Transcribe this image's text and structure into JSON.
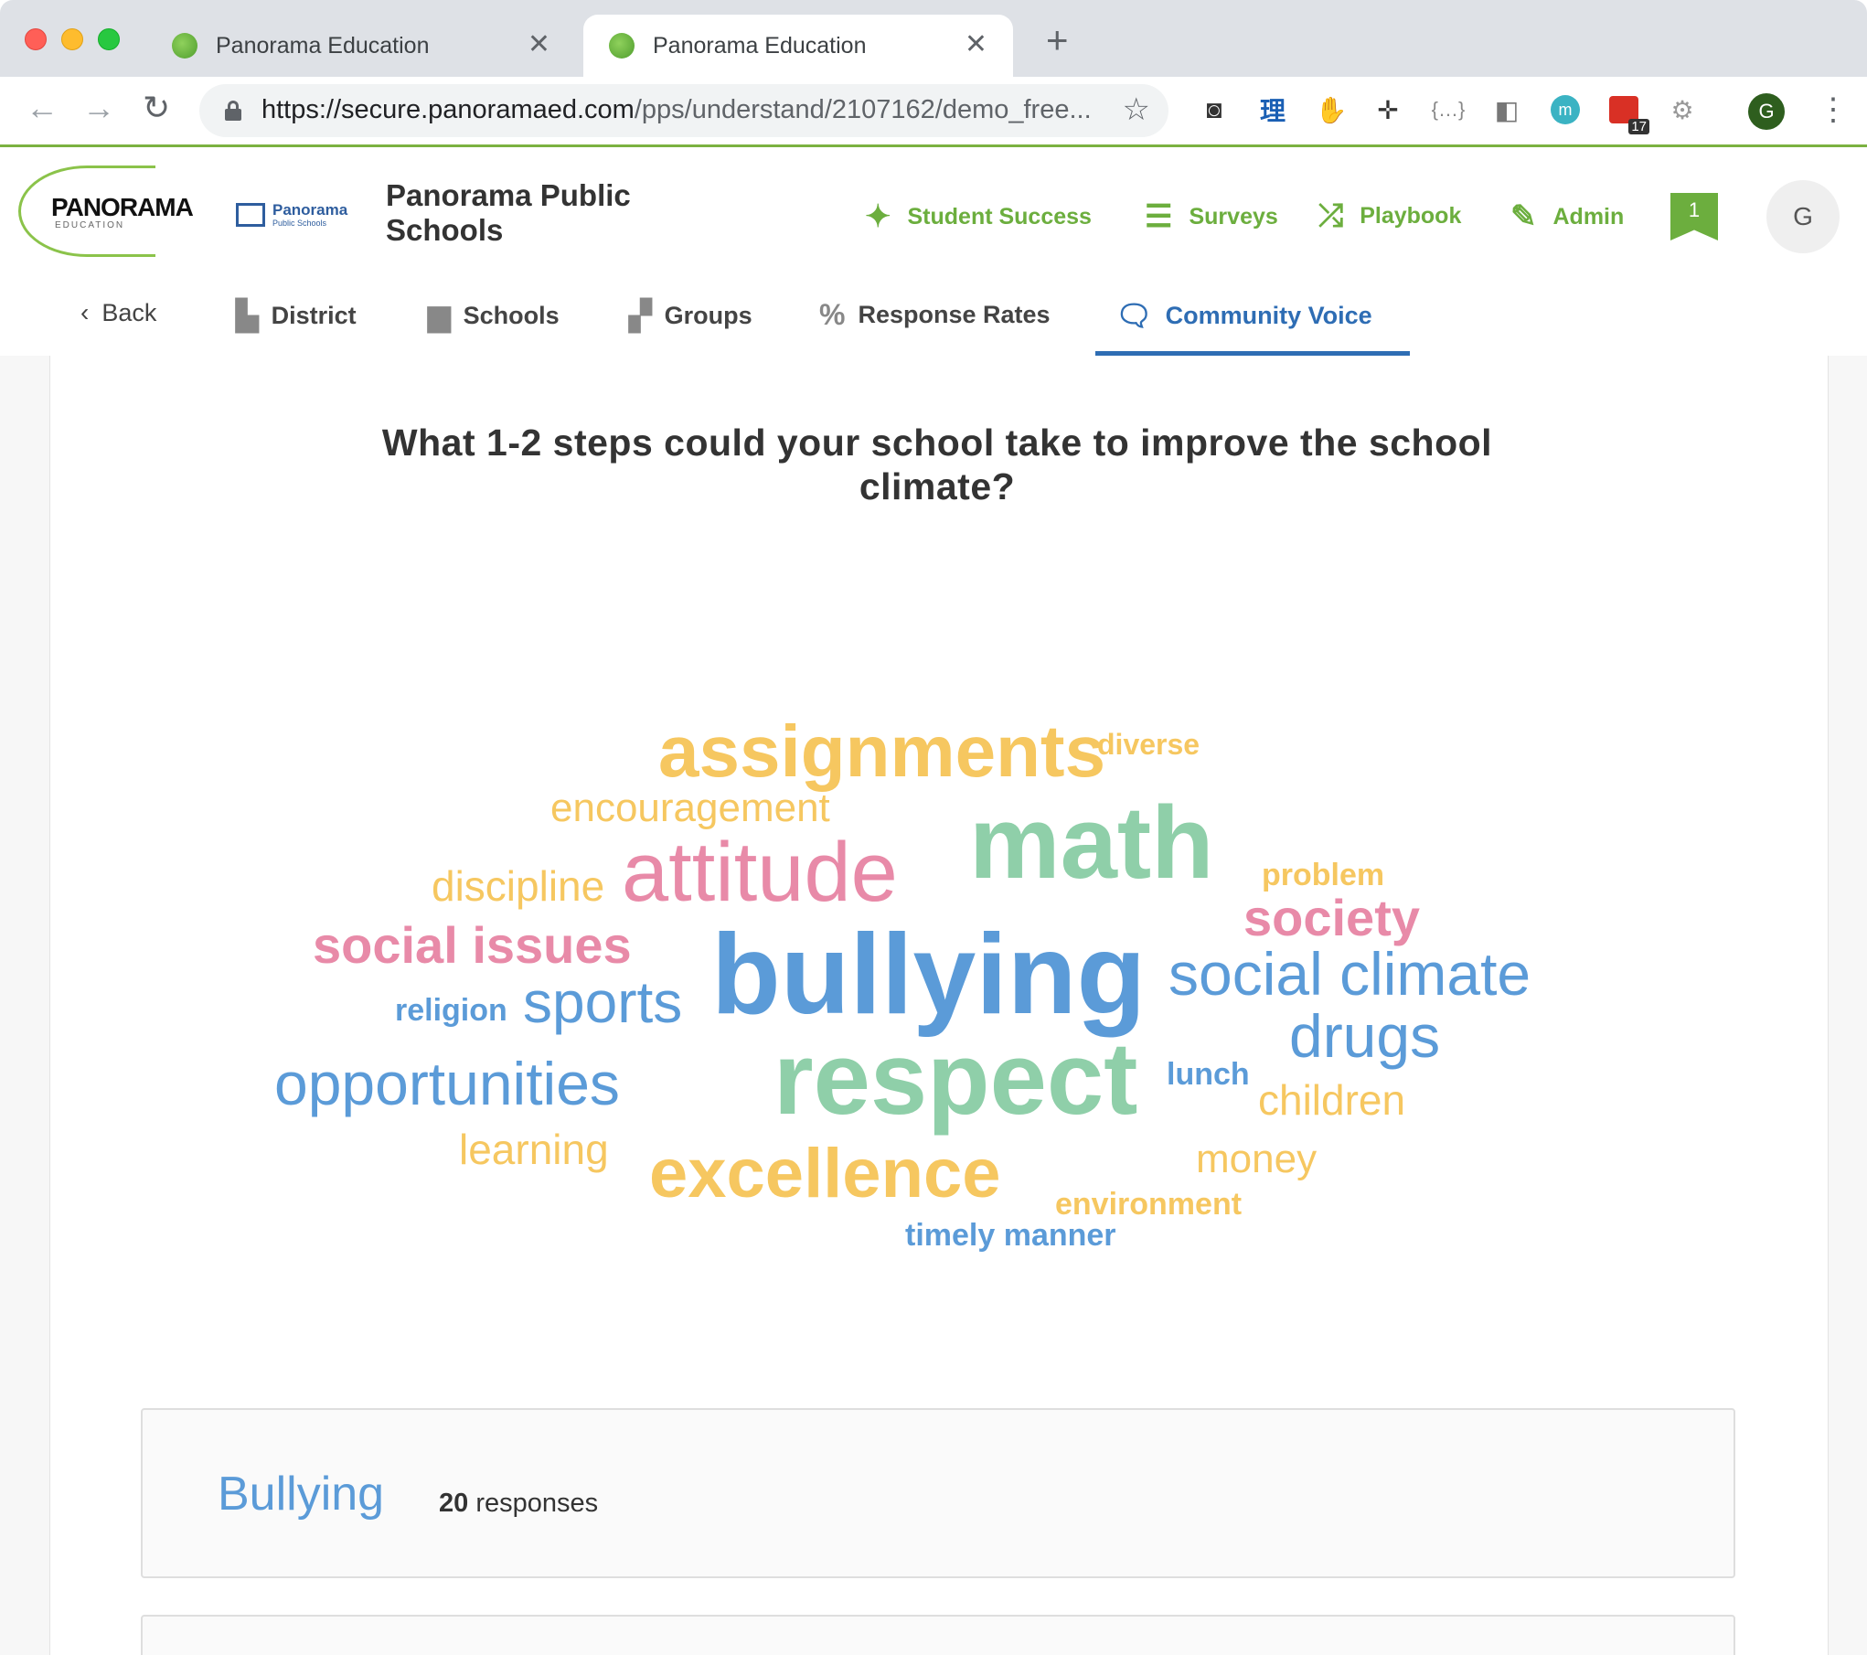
{
  "browser": {
    "tabs": [
      {
        "title": "Panorama Education"
      },
      {
        "title": "Panorama Education"
      }
    ],
    "url_host": "https://secure.panoramaed.com",
    "url_path": "/pps/understand/2107162/demo_free...",
    "profile_initial": "G",
    "extension_badge": "17"
  },
  "header": {
    "logo_text": "PANORAMA",
    "logo_sub": "EDUCATION",
    "pps_logo_name": "Panorama",
    "pps_logo_sub": "Public Schools",
    "district_name": "Panorama Public Schools",
    "nav": [
      {
        "label": "Student Success",
        "icon": "sparkle-icon"
      },
      {
        "label": "Surveys",
        "icon": "bars-icon"
      },
      {
        "label": "Playbook",
        "icon": "playbook-icon"
      },
      {
        "label": "Admin",
        "icon": "ruler-pencil-icon"
      }
    ],
    "notification_count": "1",
    "avatar_initial": "G"
  },
  "subnav": {
    "back_label": "Back",
    "items": [
      {
        "label": "District",
        "icon": "buildings-icon"
      },
      {
        "label": "Schools",
        "icon": "school-icon"
      },
      {
        "label": "Groups",
        "icon": "groups-icon"
      },
      {
        "label": "Response Rates",
        "icon": "percent-icon"
      },
      {
        "label": "Community Voice",
        "icon": "speech-bubble-icon",
        "active": true
      }
    ]
  },
  "question": "What 1-2 steps could your school take to improve the school climate?",
  "word_cloud": [
    {
      "text": "assignments",
      "color": "#f6c760"
    },
    {
      "text": "diverse",
      "color": "#f6c760"
    },
    {
      "text": "encouragement",
      "color": "#f6c760"
    },
    {
      "text": "math",
      "color": "#8fcfa9"
    },
    {
      "text": "discipline",
      "color": "#f6c760"
    },
    {
      "text": "attitude",
      "color": "#e88aa8"
    },
    {
      "text": "problem",
      "color": "#f6c760"
    },
    {
      "text": "society",
      "color": "#e88aa8"
    },
    {
      "text": "social issues",
      "color": "#e88aa8"
    },
    {
      "text": "bullying",
      "color": "#5b9bd8"
    },
    {
      "text": "social climate",
      "color": "#5b9bd8"
    },
    {
      "text": "religion",
      "color": "#5b9bd8"
    },
    {
      "text": "sports",
      "color": "#5b9bd8"
    },
    {
      "text": "drugs",
      "color": "#5b9bd8"
    },
    {
      "text": "opportunities",
      "color": "#5b9bd8"
    },
    {
      "text": "respect",
      "color": "#8fcfa9"
    },
    {
      "text": "lunch",
      "color": "#5b9bd8"
    },
    {
      "text": "children",
      "color": "#f6c760"
    },
    {
      "text": "learning",
      "color": "#f6c760"
    },
    {
      "text": "excellence",
      "color": "#f6c760"
    },
    {
      "text": "money",
      "color": "#f6c760"
    },
    {
      "text": "environment",
      "color": "#f6c760"
    },
    {
      "text": "timely manner",
      "color": "#5b9bd8"
    }
  ],
  "responses": {
    "title": "Bullying",
    "count": "20",
    "count_label": "responses"
  }
}
